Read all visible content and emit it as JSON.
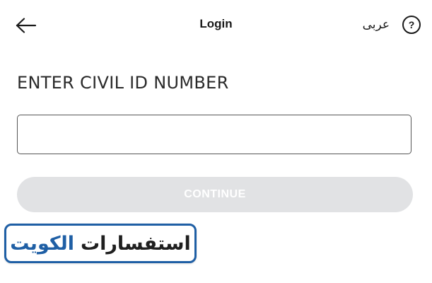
{
  "header": {
    "title": "Login",
    "language_toggle_label": "عربى",
    "help_glyph": "?",
    "back_icon": "arrow-left-icon",
    "help_icon": "question-circle-icon"
  },
  "form": {
    "civil_id_label": "ENTER CIVIL ID NUMBER",
    "civil_id_value": "",
    "continue_label": "CONTINUE",
    "continue_enabled": false
  },
  "watermark": {
    "part1": "استفسارات",
    "part2": "الكويت"
  },
  "colors": {
    "button_disabled_bg": "#e1e2e4",
    "button_disabled_text": "#ffffff",
    "watermark_accent": "#1f5fa5",
    "text": "#1a1a1a"
  }
}
